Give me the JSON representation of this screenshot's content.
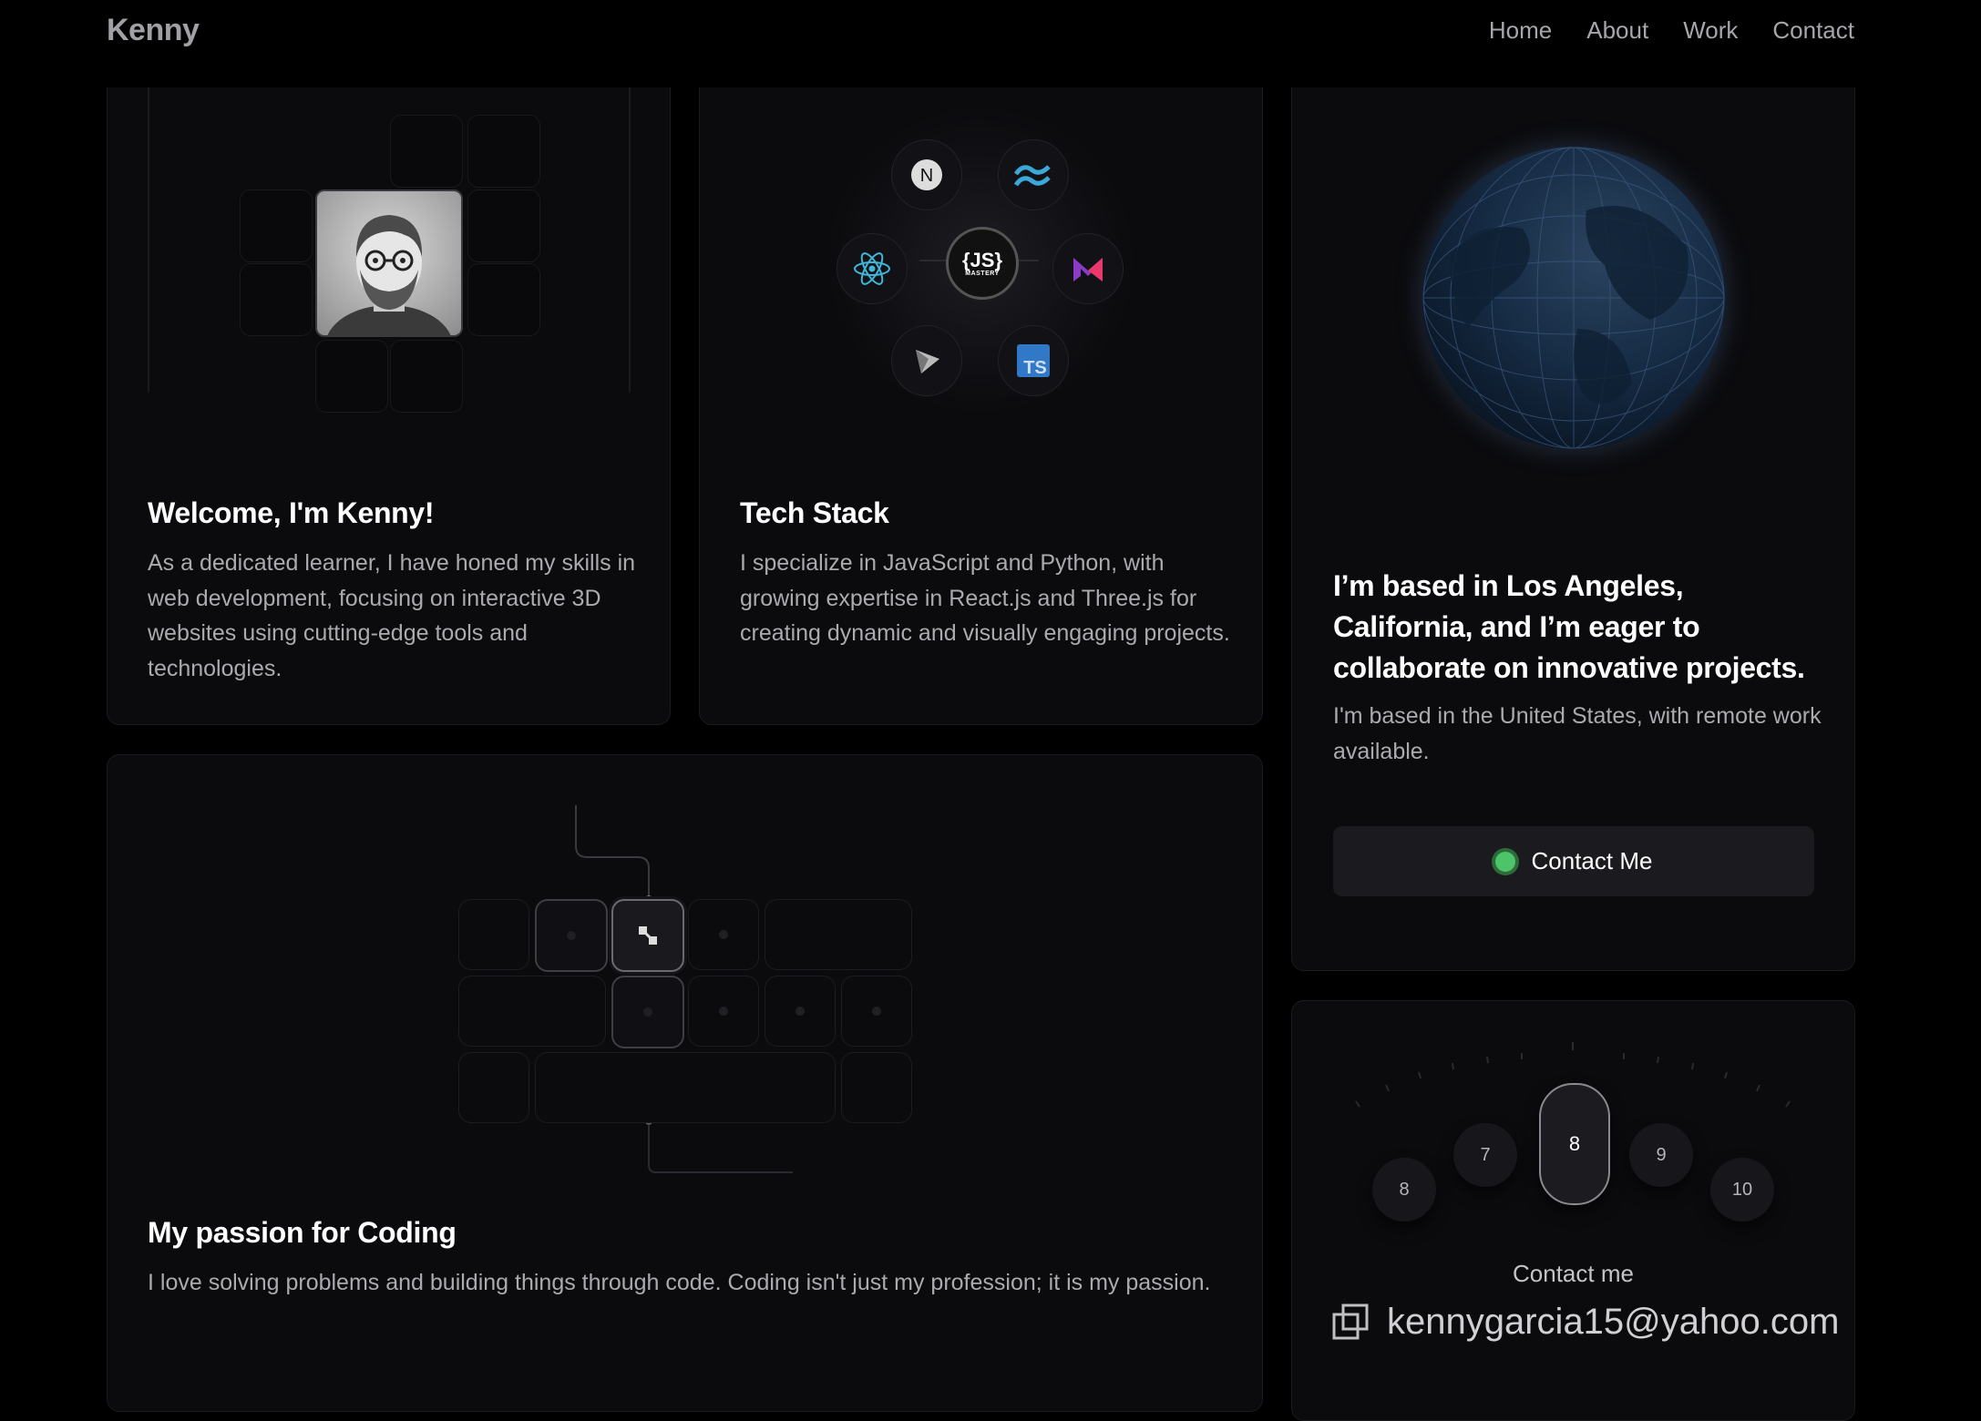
{
  "nav": {
    "brand": "Kenny",
    "links": [
      "Home",
      "About",
      "Work",
      "Contact"
    ]
  },
  "welcome": {
    "title": "Welcome, I'm Kenny!",
    "body": "As a dedicated learner, I have honed my skills in web development, focusing on interactive 3D websites using cutting-edge tools and technologies."
  },
  "tech": {
    "title": "Tech Stack",
    "body": "I specialize in JavaScript and Python, with growing expertise in React.js and Three.js for creating dynamic and visually engaging projects.",
    "center_label": "{JS}",
    "center_sub": "MASTERY",
    "icons": [
      "nextjs-icon",
      "tailwind-icon",
      "react-icon",
      "vite-icon",
      "typescript-icon",
      "mui-icon"
    ]
  },
  "location": {
    "title": "I’m based in Los Angeles, California, and I’m eager to collaborate on innovative projects.",
    "body": "I'm based in the United States, with remote work available.",
    "button": "Contact Me"
  },
  "coding": {
    "title": "My passion for Coding",
    "body": "I love solving problems and building things through code. Coding isn't just my profession; it is my passion."
  },
  "contact": {
    "dial": [
      "8",
      "7",
      "8",
      "9",
      "10"
    ],
    "selected": "8",
    "label": "Contact me",
    "email": "kennygarcia15@yahoo.com"
  }
}
